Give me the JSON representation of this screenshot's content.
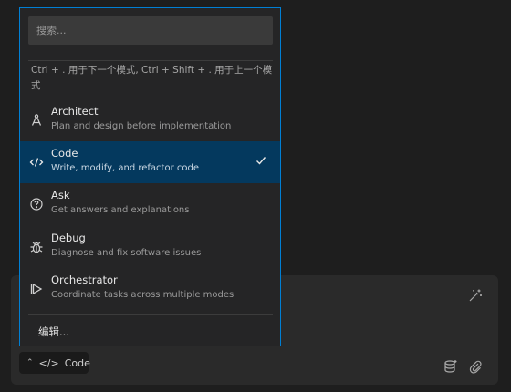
{
  "search": {
    "placeholder": "搜索..."
  },
  "hint": "Ctrl + . 用于下一个模式, Ctrl + Shift + . 用于上一个模式",
  "modes": [
    {
      "name": "Architect",
      "description": "Plan and design before implementation",
      "icon": "architect-icon",
      "selected": false
    },
    {
      "name": "Code",
      "description": "Write, modify, and refactor code",
      "icon": "code-icon",
      "selected": true
    },
    {
      "name": "Ask",
      "description": "Get answers and explanations",
      "icon": "question-icon",
      "selected": false
    },
    {
      "name": "Debug",
      "description": "Diagnose and fix software issues",
      "icon": "bug-icon",
      "selected": false
    },
    {
      "name": "Orchestrator",
      "description": "Coordinate tasks across multiple modes",
      "icon": "orchestrator-icon",
      "selected": false
    }
  ],
  "edit_label": "编辑...",
  "mode_chip": {
    "label": "Code",
    "icon": "code-icon"
  },
  "toolbar_icons": [
    "enhance-prompt-icon",
    "database-icon",
    "paperclip-icon"
  ],
  "colors": {
    "accent_border": "#007fd4",
    "selected_bg": "#04395e",
    "panel_bg": "#252526"
  }
}
